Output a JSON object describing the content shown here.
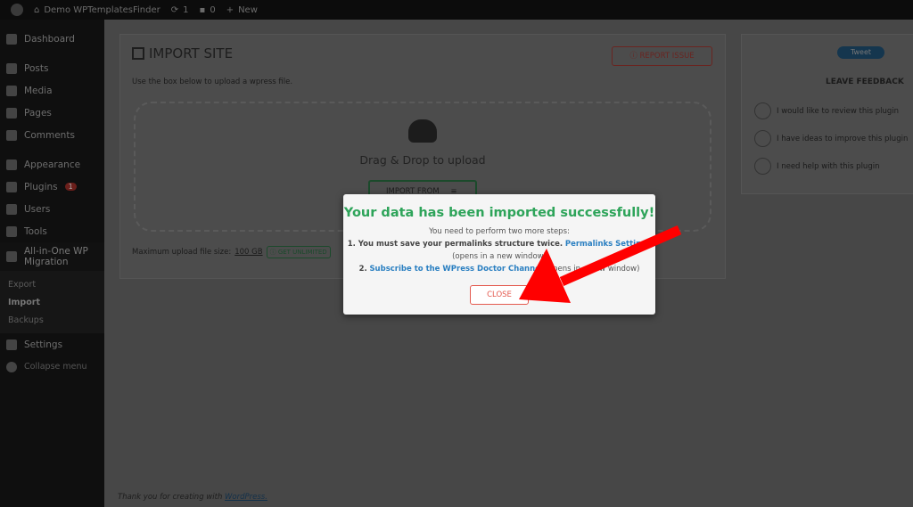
{
  "adminbar": {
    "site": "Demo WPTemplatesFinder",
    "updates": "1",
    "comments": "0",
    "new": "New"
  },
  "sidebar": {
    "items": [
      {
        "label": "Dashboard"
      },
      {
        "label": "Posts"
      },
      {
        "label": "Media"
      },
      {
        "label": "Pages"
      },
      {
        "label": "Comments"
      },
      {
        "label": "Appearance"
      },
      {
        "label": "Plugins",
        "badge": "1"
      },
      {
        "label": "Users"
      },
      {
        "label": "Tools"
      },
      {
        "label": "All-in-One WP Migration"
      }
    ],
    "subitems": [
      "Export",
      "Import",
      "Backups"
    ],
    "settings": "Settings",
    "collapse": "Collapse menu"
  },
  "main": {
    "title": "IMPORT SITE",
    "report": "REPORT ISSUE",
    "instructions": "Use the box below to upload a wpress file.",
    "drag": "Drag & Drop to upload",
    "import_from": "IMPORT FROM",
    "max_label": "Maximum upload file size:",
    "max_value": "100 GB",
    "get_unlimited": "GET UNLIMITED"
  },
  "feedback": {
    "tweet": "Tweet",
    "title": "LEAVE FEEDBACK",
    "options": [
      "I would like to review this plugin",
      "I have ideas to improve this plugin",
      "I need help with this plugin"
    ]
  },
  "footer": {
    "text": "Thank you for creating with",
    "link": "WordPress."
  },
  "modal": {
    "title": "Your data has been imported successfully!",
    "intro": "You need to perform two more steps:",
    "step1": "1. You must save your permalinks structure twice.",
    "step1_link": "Permalinks Settings",
    "step1_note": "(opens in a new window)",
    "step2": "2.",
    "step2_link": "Subscribe to the WPress Doctor Channel",
    "step2_note": "(opens in a new window)",
    "close": "CLOSE"
  },
  "colors": {
    "success": "#2ea45a",
    "link": "#2a7fc1",
    "danger": "#e45a4f",
    "arrow": "#ff0000"
  }
}
